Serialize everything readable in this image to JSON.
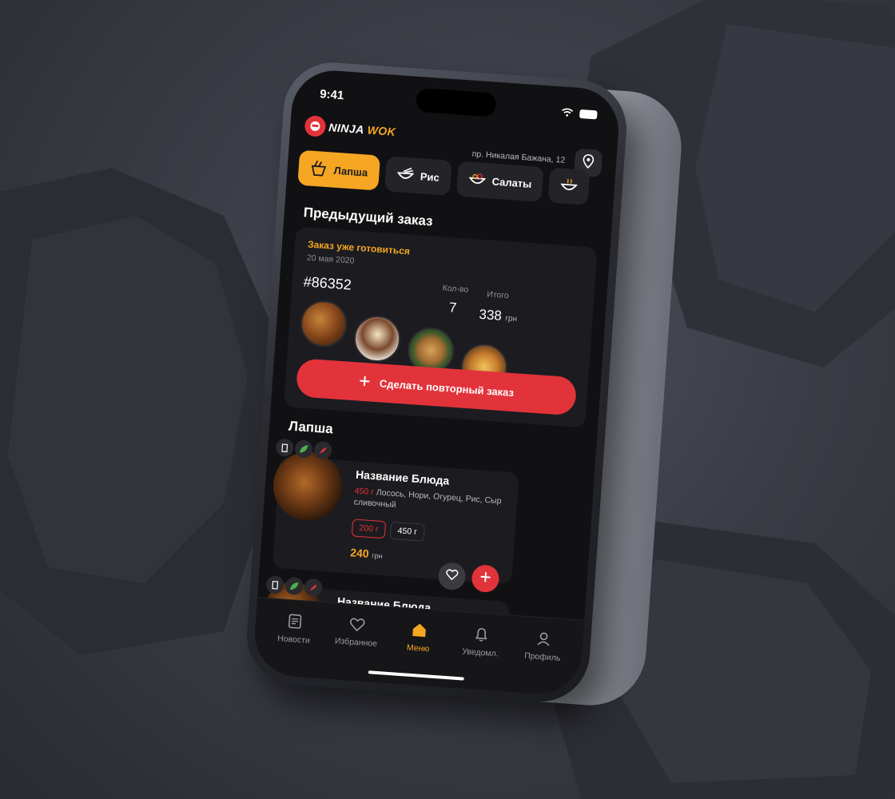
{
  "status": {
    "time": "9:41"
  },
  "header": {
    "logo_word1": "NINJA",
    "logo_word2": "WOK",
    "address": "пр. Никалая Бажана, 12"
  },
  "categories": [
    {
      "label": "Лапша",
      "icon": "noodles-icon",
      "active": true
    },
    {
      "label": "Рис",
      "icon": "rice-bowl-icon",
      "active": false
    },
    {
      "label": "Салаты",
      "icon": "salad-icon",
      "active": false
    }
  ],
  "previous_order": {
    "section_title": "Предыдущий заказ",
    "status": "Заказ уже готовиться",
    "date": "20 мая 2020",
    "number": "#86352",
    "qty_label": "Кол-во",
    "qty": "7",
    "total_label": "Итого",
    "total": "338",
    "currency": "грн",
    "repeat_button": "Сделать повторный заказ"
  },
  "menu_section": {
    "title": "Лапша"
  },
  "items": [
    {
      "name": "Название Блюда",
      "weight": "450 г",
      "desc": "Лосось, Нори, Огурец, Рис, Сыр сливочный",
      "weights": [
        "200 г",
        "450 г"
      ],
      "price": "240",
      "currency": "грн"
    },
    {
      "name": "Название Блюда"
    }
  ],
  "tabbar": [
    {
      "label": "Новости",
      "icon": "news-icon",
      "active": false
    },
    {
      "label": "Избранное",
      "icon": "heart-icon",
      "active": false
    },
    {
      "label": "Меню",
      "icon": "home-icon",
      "active": true
    },
    {
      "label": "Уведомл.",
      "icon": "bell-icon",
      "active": false
    },
    {
      "label": "Профиль",
      "icon": "user-icon",
      "active": false
    }
  ],
  "colors": {
    "accent": "#f5a623",
    "primary": "#e2333a",
    "background": "#111113"
  }
}
